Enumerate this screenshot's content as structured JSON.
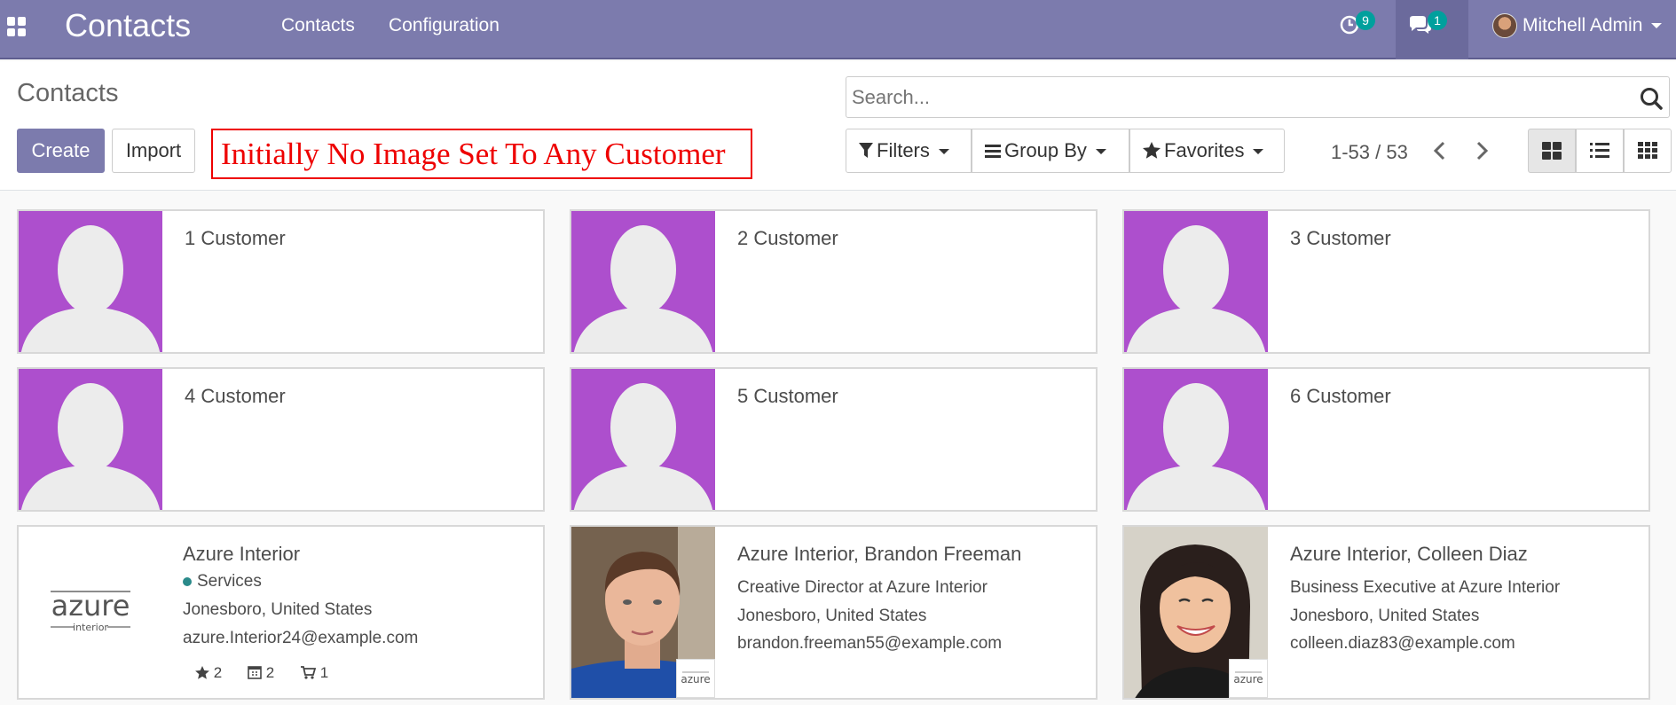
{
  "navbar": {
    "brand": "Contacts",
    "menu": [
      "Contacts",
      "Configuration"
    ],
    "activity_count": "9",
    "message_count": "1",
    "user_name": "Mitchell Admin"
  },
  "control_panel": {
    "breadcrumb": "Contacts",
    "create_label": "Create",
    "import_label": "Import",
    "annotation": "Initially No Image Set To Any Customer",
    "search_placeholder": "Search...",
    "filters_label": "Filters",
    "group_by_label": "Group By",
    "favorites_label": "Favorites",
    "pager": "1-53 / 53"
  },
  "colors": {
    "brand": "#7c7bad",
    "placeholder_bg": "#ad4fcd",
    "badge": "#00a09d",
    "annotation": "#e00000"
  },
  "cards": [
    {
      "name": "1 Customer"
    },
    {
      "name": "2 Customer"
    },
    {
      "name": "3 Customer"
    },
    {
      "name": "4 Customer"
    },
    {
      "name": "5 Customer"
    },
    {
      "name": "6 Customer"
    },
    {
      "name": "Azure Interior",
      "logo_text": "azure",
      "logo_sub": "interior",
      "tag": "Services",
      "location": "Jonesboro, United States",
      "email": "azure.Interior24@example.com",
      "stats": {
        "favorites": "2",
        "meetings": "2",
        "orders": "1"
      }
    },
    {
      "name": "Azure Interior, Brandon Freeman",
      "function": "Creative Director at Azure Interior",
      "location": "Jonesboro, United States",
      "email": "brandon.freeman55@example.com",
      "badge_text": "azure"
    },
    {
      "name": "Azure Interior, Colleen Diaz",
      "function": "Business Executive at Azure Interior",
      "location": "Jonesboro, United States",
      "email": "colleen.diaz83@example.com",
      "badge_text": "azure"
    }
  ]
}
